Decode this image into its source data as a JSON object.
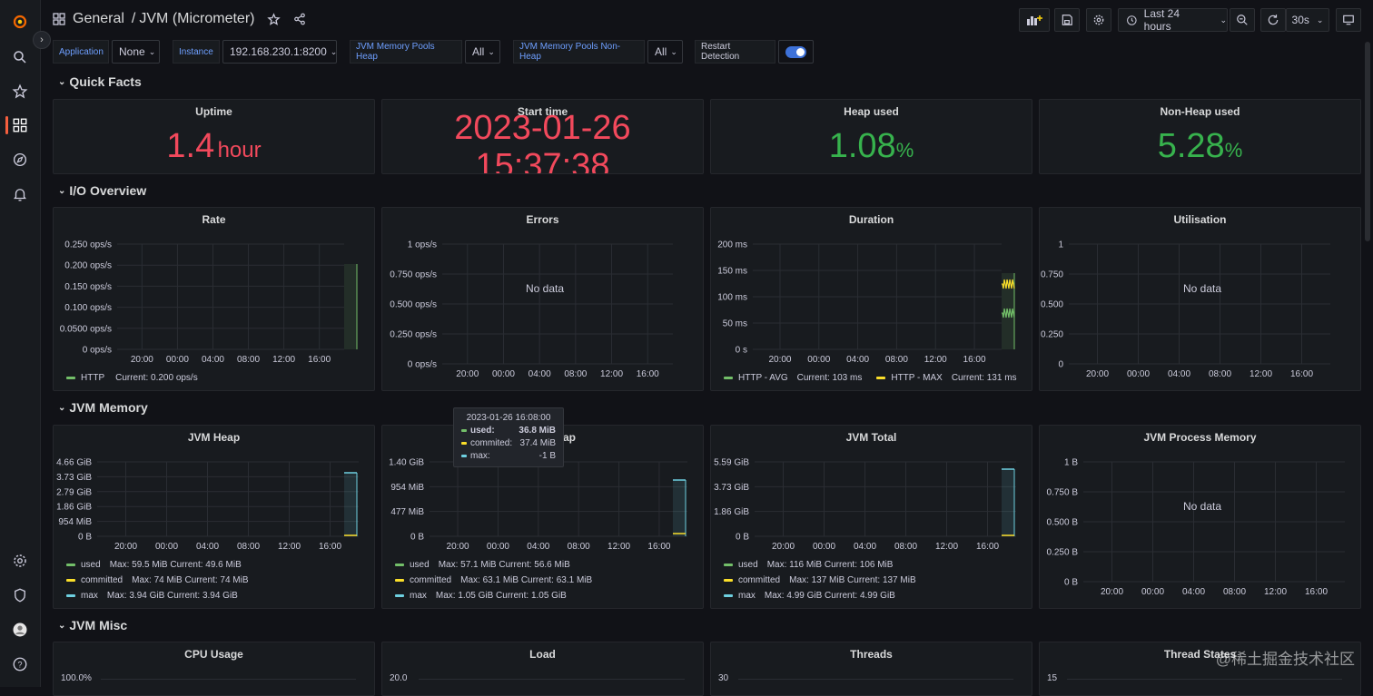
{
  "breadcrumb": {
    "folder": "General",
    "separator": "/",
    "dashboard": "JVM (Micrometer)"
  },
  "toolbar": {
    "time_range": "Last 24 hours",
    "refresh_interval": "30s"
  },
  "variables": [
    {
      "label": "Application",
      "value": "None"
    },
    {
      "label": "Instance",
      "value": "192.168.230.1:8200"
    },
    {
      "label": "JVM Memory Pools Heap",
      "value": "All"
    },
    {
      "label": "JVM Memory Pools Non-Heap",
      "value": "All"
    },
    {
      "label": "Restart Detection",
      "toggle": true
    }
  ],
  "rows": {
    "quick_facts": "Quick Facts",
    "io_overview": "I/O Overview",
    "jvm_memory": "JVM Memory",
    "jvm_misc": "JVM Misc"
  },
  "quick_facts": {
    "uptime": {
      "title": "Uptime",
      "value": "1.4",
      "unit": "hour"
    },
    "start_time": {
      "title": "Start time",
      "date": "2023-01-26",
      "time": "15:37:38"
    },
    "heap_used": {
      "title": "Heap used",
      "value": "1.08",
      "unit": "%"
    },
    "nonheap_used": {
      "title": "Non-Heap used",
      "value": "5.28",
      "unit": "%"
    }
  },
  "x_ticks": [
    "20:00",
    "00:00",
    "04:00",
    "08:00",
    "12:00",
    "16:00"
  ],
  "no_data": "No data",
  "panels": {
    "rate": {
      "title": "Rate",
      "yticks": [
        "0.250 ops/s",
        "0.200 ops/s",
        "0.150 ops/s",
        "0.100 ops/s",
        "0.0500 ops/s",
        "0 ops/s"
      ],
      "legend": [
        {
          "name": "HTTP",
          "stats": "Current: 0.200 ops/s",
          "color": "#73bf69"
        }
      ]
    },
    "errors": {
      "title": "Errors",
      "yticks": [
        "1 ops/s",
        "0.750 ops/s",
        "0.500 ops/s",
        "0.250 ops/s",
        "0 ops/s"
      ]
    },
    "duration": {
      "title": "Duration",
      "yticks": [
        "200 ms",
        "150 ms",
        "100 ms",
        "50 ms",
        "0 s"
      ],
      "legend": [
        {
          "name": "HTTP - AVG",
          "stats": "Current: 103 ms",
          "color": "#73bf69"
        },
        {
          "name": "HTTP - MAX",
          "stats": "Current: 131 ms",
          "color": "#fade2a"
        }
      ]
    },
    "utilisation": {
      "title": "Utilisation",
      "yticks": [
        "1",
        "0.750",
        "0.500",
        "0.250",
        "0"
      ]
    },
    "jvm_heap": {
      "title": "JVM Heap",
      "yticks": [
        "4.66 GiB",
        "3.73 GiB",
        "2.79 GiB",
        "1.86 GiB",
        "954 MiB",
        "0 B"
      ],
      "legend": [
        {
          "name": "used",
          "stats": "Max: 59.5 MiB  Current: 49.6 MiB",
          "color": "#73bf69"
        },
        {
          "name": "committed",
          "stats": "Max: 74 MiB  Current: 74 MiB",
          "color": "#fade2a"
        },
        {
          "name": "max",
          "stats": "Max: 3.94 GiB  Current: 3.94 GiB",
          "color": "#6ed0e0"
        }
      ]
    },
    "jvm_nonheap": {
      "title": "JVM Non-Heap",
      "title_visible": "ap",
      "yticks": [
        "1.40 GiB",
        "954 MiB",
        "477 MiB",
        "0 B"
      ],
      "legend": [
        {
          "name": "used",
          "stats": "Max: 57.1 MiB  Current: 56.6 MiB",
          "color": "#73bf69"
        },
        {
          "name": "committed",
          "stats": "Max: 63.1 MiB  Current: 63.1 MiB",
          "color": "#fade2a"
        },
        {
          "name": "max",
          "stats": "Max: 1.05 GiB  Current: 1.05 GiB",
          "color": "#6ed0e0"
        }
      ]
    },
    "jvm_total": {
      "title": "JVM Total",
      "yticks": [
        "5.59 GiB",
        "3.73 GiB",
        "1.86 GiB",
        "0 B"
      ],
      "legend": [
        {
          "name": "used",
          "stats": "Max: 116 MiB  Current: 106 MiB",
          "color": "#73bf69"
        },
        {
          "name": "committed",
          "stats": "Max: 137 MiB  Current: 137 MiB",
          "color": "#fade2a"
        },
        {
          "name": "max",
          "stats": "Max: 4.99 GiB  Current: 4.99 GiB",
          "color": "#6ed0e0"
        }
      ]
    },
    "jvm_process": {
      "title": "JVM Process Memory",
      "yticks": [
        "1 B",
        "0.750 B",
        "0.500 B",
        "0.250 B",
        "0 B"
      ]
    },
    "cpu": {
      "title": "CPU Usage",
      "ytop": "100.0%"
    },
    "load": {
      "title": "Load",
      "ytop": "20.0"
    },
    "threads": {
      "title": "Threads",
      "ytop": "30"
    },
    "thread_states": {
      "title": "Thread States",
      "ytop": "15"
    }
  },
  "tooltip": {
    "time": "2023-01-26 16:08:00",
    "rows": [
      {
        "name": "used:",
        "value": "36.8 MiB",
        "color": "#73bf69"
      },
      {
        "name": "commited:",
        "value": "37.4 MiB",
        "color": "#fade2a"
      },
      {
        "name": "max:",
        "value": "-1 B",
        "color": "#6ed0e0"
      }
    ]
  },
  "watermark": "@稀土掘金技术社区",
  "colors": {
    "red": "#f2495c",
    "green": "#37b24d",
    "accent": "#3d71d9"
  }
}
